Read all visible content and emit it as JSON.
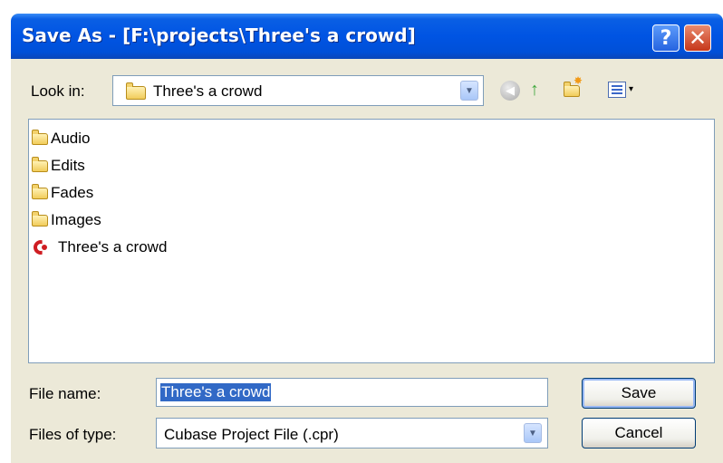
{
  "window": {
    "title": "Save As - [F:\\projects\\Three's a crowd]",
    "help_glyph": "?",
    "close_glyph": "✕"
  },
  "lookin": {
    "label": "Look in:",
    "value": "Three's a crowd",
    "dropdown_glyph": "▼"
  },
  "toolbar": {
    "back_glyph": "◀",
    "up_glyph": "↑",
    "views_arrow": "▾"
  },
  "files": [
    {
      "name": "Audio",
      "icon": "folder-icon"
    },
    {
      "name": "Edits",
      "icon": "folder-icon"
    },
    {
      "name": "Fades",
      "icon": "folder-icon"
    },
    {
      "name": "Images",
      "icon": "folder-icon"
    },
    {
      "name": "Three's a crowd",
      "icon": "cubase-project-icon"
    }
  ],
  "filename": {
    "label": "File name:",
    "value": "Three's a crowd"
  },
  "filetype": {
    "label": "Files of type:",
    "value": "Cubase Project File (.cpr)",
    "dropdown_glyph": "▼"
  },
  "buttons": {
    "save": "Save",
    "cancel": "Cancel"
  },
  "colors": {
    "titlebar": "#0054E3",
    "dialog": "#ECE9D8",
    "selection": "#3169C6"
  }
}
